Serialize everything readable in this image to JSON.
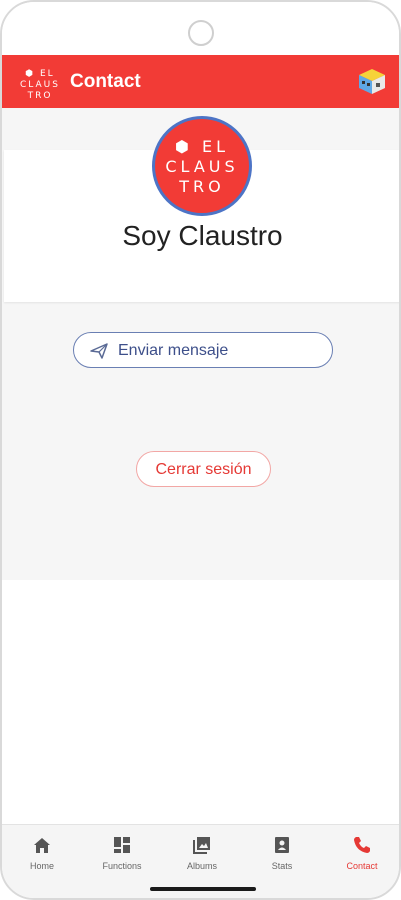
{
  "appbar": {
    "logo_line1": "⬢ EL",
    "logo_line2": "CLAUS",
    "logo_line3": "TRO",
    "title": "Contact",
    "right_icon": "cube-app-icon"
  },
  "profile": {
    "avatar_line1": "⬢ EL",
    "avatar_line2": "CLAUS",
    "avatar_line3": "TRO",
    "name": "Soy Claustro"
  },
  "actions": {
    "send_message": "Enviar mensaje",
    "logout": "Cerrar sesión"
  },
  "bottom_nav": {
    "items": [
      {
        "label": "Home",
        "icon": "home-icon"
      },
      {
        "label": "Functions",
        "icon": "dashboard-icon"
      },
      {
        "label": "Albums",
        "icon": "photo-library-icon"
      },
      {
        "label": "Stats",
        "icon": "stats-icon"
      },
      {
        "label": "Contact",
        "icon": "phone-icon"
      }
    ],
    "active": "Contact"
  },
  "colors": {
    "primary": "#f23b36",
    "accent_blue": "#4d74c6",
    "logout_text": "#e53935"
  }
}
